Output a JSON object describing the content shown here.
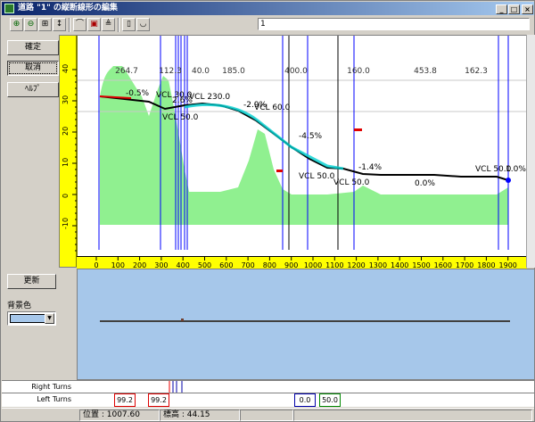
{
  "window": {
    "title": "道路 \"1\" の縦断線形の編集",
    "id_value": "1"
  },
  "toolbar": {
    "icons": [
      "zoom-in-icon",
      "zoom-out-icon",
      "fit-icon",
      "height-scale-icon",
      "curve-icon",
      "vertical-curve-icon",
      "cross-section-icon",
      "document-icon",
      "bowl-icon"
    ]
  },
  "left_panel": {
    "ok_label": "確定",
    "cancel_label": "取消",
    "help_label": "ﾍﾙﾌﾟ"
  },
  "bottom_panel": {
    "update_label": "更新",
    "bg_color_label": "背景色",
    "bg_color_value": "#a6c7ea"
  },
  "profile": {
    "y_ticks": [
      "40",
      "30",
      "20",
      "10",
      "0",
      "-10"
    ],
    "x_ticks": [
      "0",
      "100",
      "200",
      "300",
      "400",
      "500",
      "600",
      "700",
      "800",
      "900",
      "1000",
      "1100",
      "1200",
      "1300",
      "1400",
      "1500",
      "1600",
      "1700",
      "1800",
      "1900"
    ],
    "segment_lengths": [
      "264.7",
      "112.3",
      "40.0",
      "185.0",
      "400.0",
      "160.0",
      "453.8",
      "162.3"
    ],
    "grades": [
      "-0.5%",
      "2.6%",
      "-2.9%",
      "-4.5%",
      "-1.4%",
      "0.0%",
      "1.0%"
    ],
    "vcl_labels": [
      "VCL 30.0",
      "VCL 50.0",
      "VCL 230.0",
      "VCL 60.0",
      "VCL 50.0",
      "VCL 50.0",
      "VCL 50.0"
    ],
    "colors": {
      "ground": "#90f090",
      "line": "#000000",
      "curve_highlight": "#00d0d0",
      "ruler": "#ffff00",
      "blue_lines": "#0000ff"
    }
  },
  "turns": {
    "right_label": "Right Turns",
    "left_label": "Left Turns",
    "left_values": [
      "99.2",
      "99.2",
      "0.0",
      "50.0"
    ]
  },
  "status": {
    "position": "位置 : 1007.60",
    "elevation": "標高 : 44.15"
  }
}
